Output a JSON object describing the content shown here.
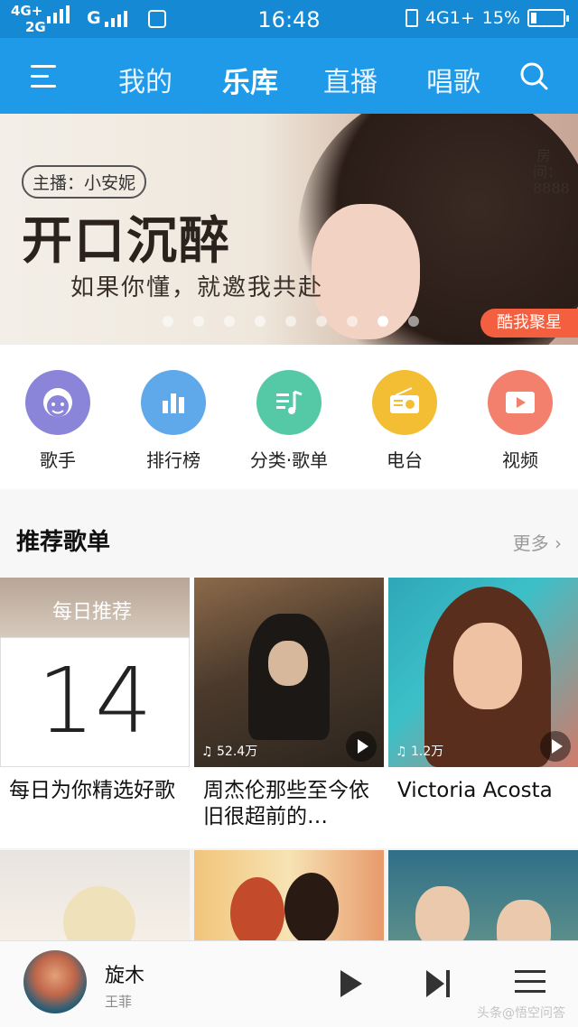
{
  "status_bar": {
    "signal_1": "4G+",
    "signal_2": "2G",
    "signal_3": "G",
    "time": "16:48",
    "network_right": "4G1+",
    "battery": "15%"
  },
  "nav": {
    "tabs": [
      {
        "label": "我的"
      },
      {
        "label": "乐库"
      },
      {
        "label": "直播"
      },
      {
        "label": "唱歌"
      }
    ],
    "active_tab": "乐库",
    "icons": [
      "menu-icon",
      "search-icon"
    ]
  },
  "banner": {
    "host": "主播：小安妮",
    "title": "开口沉醉",
    "subtitle": "如果你懂，就邀我共赴",
    "room": "房间：8888",
    "badge": "酷我聚星"
  },
  "categories": [
    {
      "label": "歌手",
      "icon": "singer-icon",
      "color": "#8a85d8"
    },
    {
      "label": "排行榜",
      "icon": "chart-icon",
      "color": "#5fa9ea"
    },
    {
      "label": "分类·歌单",
      "icon": "playlist-icon",
      "color": "#55c9a6"
    },
    {
      "label": "电台",
      "icon": "radio-icon",
      "color": "#f3be33"
    },
    {
      "label": "视频",
      "icon": "video-icon",
      "color": "#f2806c"
    }
  ],
  "section": {
    "title": "推荐歌单",
    "more": "更多"
  },
  "playlists": [
    {
      "name": "每日为你精选好歌",
      "badge": "每日推荐",
      "day": "14"
    },
    {
      "name": "周杰伦那些至今依旧很超前的…",
      "plays": "52.4万"
    },
    {
      "name": "Victoria Acosta",
      "plays": "1.2万"
    }
  ],
  "player": {
    "song": "旋木",
    "artist": "王菲"
  },
  "watermark": "头条@悟空问答"
}
